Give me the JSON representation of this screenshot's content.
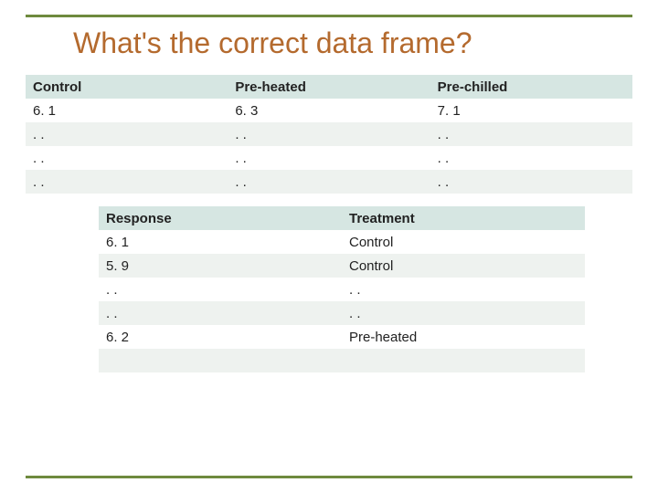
{
  "title": "What's the correct data frame?",
  "table1": {
    "headers": [
      "Control",
      "Pre-heated",
      "Pre-chilled"
    ],
    "rows": [
      [
        "6. 1",
        "6. 3",
        "7. 1"
      ],
      [
        ". .",
        ". .",
        ". ."
      ],
      [
        ". .",
        ". .",
        ". ."
      ],
      [
        ". .",
        ". .",
        ". ."
      ]
    ]
  },
  "table2": {
    "headers": [
      "Response",
      "Treatment"
    ],
    "rows": [
      [
        "6. 1",
        "Control"
      ],
      [
        "5. 9",
        "Control"
      ],
      [
        ". .",
        ". ."
      ],
      [
        ". .",
        ". ."
      ],
      [
        "6. 2",
        "Pre-heated"
      ],
      [
        "",
        ""
      ],
      [
        "",
        ""
      ]
    ]
  },
  "chart_data": [
    {
      "type": "table",
      "title": "Wide-format data frame",
      "columns": [
        "Control",
        "Pre-heated",
        "Pre-chilled"
      ],
      "rows": [
        [
          6.1,
          6.3,
          7.1
        ],
        [
          "..",
          "..",
          ".."
        ],
        [
          "..",
          "..",
          ".."
        ],
        [
          "..",
          "..",
          ".."
        ]
      ]
    },
    {
      "type": "table",
      "title": "Long-format data frame",
      "columns": [
        "Response",
        "Treatment"
      ],
      "rows": [
        [
          6.1,
          "Control"
        ],
        [
          5.9,
          "Control"
        ],
        [
          "..",
          ".."
        ],
        [
          "..",
          ".."
        ],
        [
          6.2,
          "Pre-heated"
        ],
        [
          "",
          ""
        ],
        [
          "",
          ""
        ]
      ]
    }
  ]
}
